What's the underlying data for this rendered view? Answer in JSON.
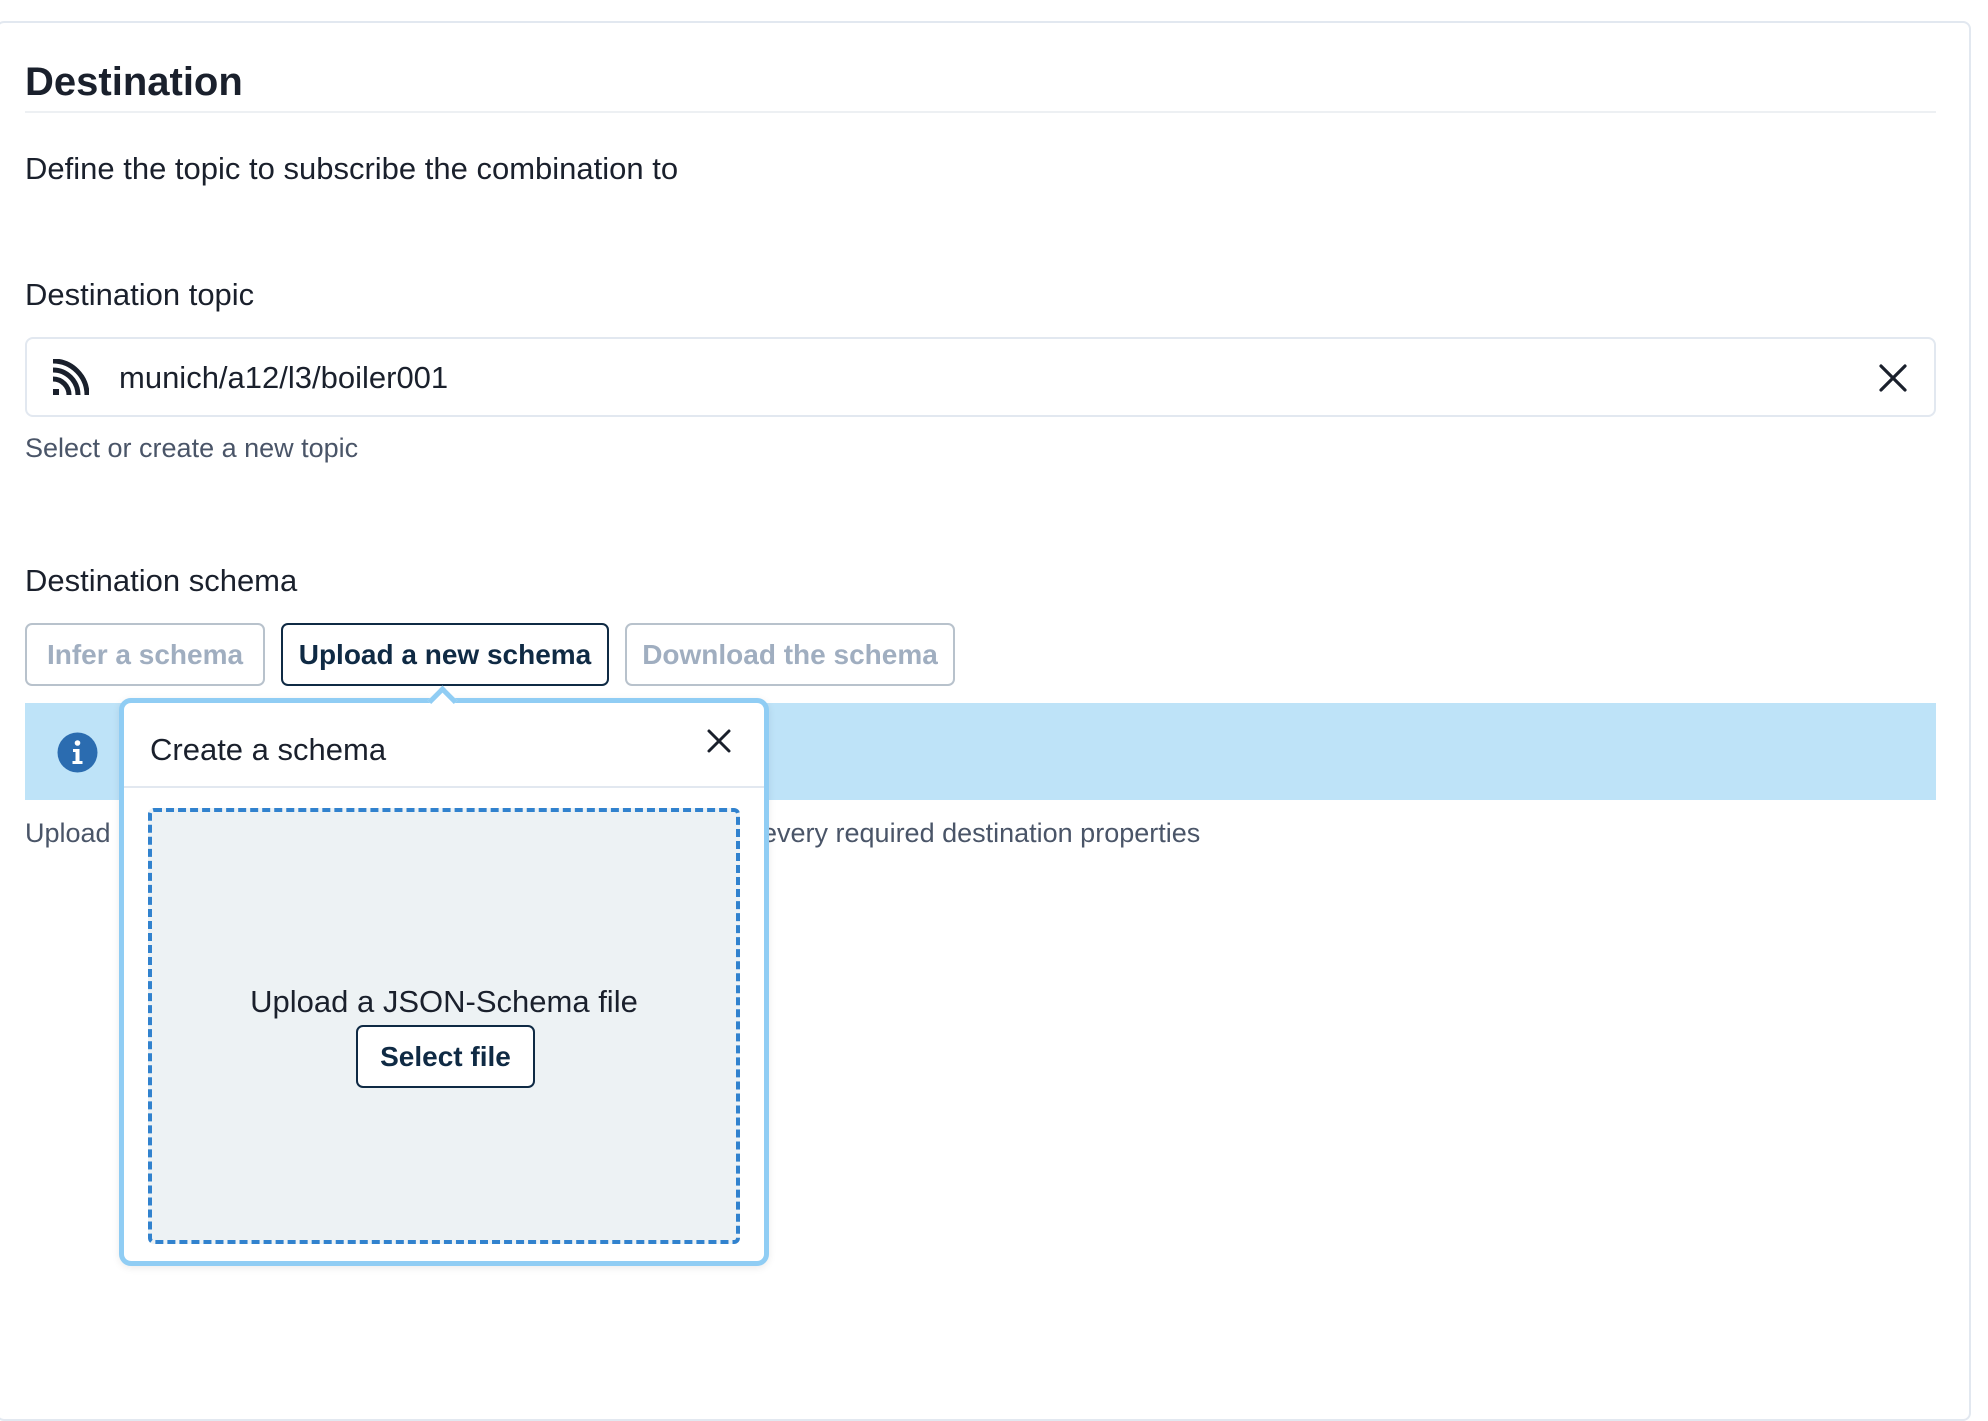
{
  "section": {
    "title": "Destination",
    "description": "Define the topic to subscribe the combination to"
  },
  "topic": {
    "label": "Destination topic",
    "value": "munich/a12/l3/boiler001",
    "helper": "Select or create a new topic",
    "icon": "rss-feed-icon",
    "clear_icon": "close-icon"
  },
  "schema": {
    "label": "Destination schema",
    "buttons": [
      {
        "label": "Infer a schema",
        "state": "disabled"
      },
      {
        "label": "Upload a new schema",
        "state": "active"
      },
      {
        "label": "Download the schema",
        "state": "disabled"
      }
    ],
    "helper_visible_start": "Upload",
    "helper_visible_end": "every required destination properties"
  },
  "alert": {
    "icon": "info-icon",
    "background": "#bee3f8"
  },
  "popover": {
    "title": "Create a schema",
    "dropzone_text": "Upload a JSON-Schema file",
    "select_button": "Select file",
    "accent_border": "#90cdf4",
    "dash_color": "#3182ce"
  },
  "colors": {
    "primary_text": "#1a202c",
    "button_dark": "#0f2a44",
    "disabled_text": "#a0aec0"
  }
}
